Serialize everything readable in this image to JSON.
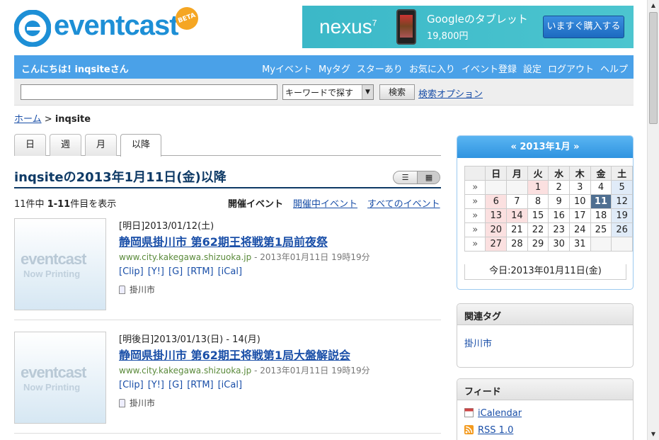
{
  "logo": {
    "text": "eventcast",
    "badge": "BETA"
  },
  "ad": {
    "brand": "nexus",
    "line1": "Googleのタブレット",
    "line2": "19,800円",
    "button": "いますぐ購入する"
  },
  "nav": {
    "greeting": "こんにちは! inqsiteさん",
    "links": [
      "Myイベント",
      "Myタグ",
      "スターあり",
      "お気に入り",
      "イベント登録",
      "設定",
      "ログアウト",
      "ヘルプ"
    ]
  },
  "search": {
    "input_value": "",
    "select_value": "キーワードで探す",
    "button": "検索",
    "options_link": "検索オプション"
  },
  "breadcrumb": {
    "home": "ホーム",
    "sep": ">",
    "current": "inqsite"
  },
  "tabs": [
    "日",
    "週",
    "月",
    "以降"
  ],
  "active_tab": "以降",
  "heading": "inqsiteの2013年1月11日(金)以降",
  "view_toggle": {
    "list": "☰",
    "grid": "▦"
  },
  "count": {
    "prefix": "11件中 ",
    "range": "1-11",
    "suffix": "件目を表示"
  },
  "filters": {
    "current": "開催イベント",
    "ongoing": "開催中イベント",
    "all": "すべてのイベント"
  },
  "events": [
    {
      "date": "[明日]2013/01/12(土)",
      "title": "静岡県掛川市 第62期王将戦第1局前夜祭",
      "url": "www.city.kakegawa.shizuoka.jp",
      "sep": " - ",
      "time": "2013年01月11日 19時19分",
      "links": [
        "[Clip]",
        "[Y!]",
        "[G]",
        "[RTM]",
        "[iCal]"
      ],
      "tag": "掛川市",
      "thumb_word": "eventcast",
      "thumb_sub": "Now Printing"
    },
    {
      "date": "[明後日]2013/01/13(日) - 14(月)",
      "title": "静岡県掛川市 第62期王将戦第1局大盤解説会",
      "url": "www.city.kakegawa.shizuoka.jp",
      "sep": " - ",
      "time": "2013年01月11日 19時19分",
      "links": [
        "[Clip]",
        "[Y!]",
        "[G]",
        "[RTM]",
        "[iCal]"
      ],
      "tag": "掛川市",
      "thumb_word": "eventcast",
      "thumb_sub": "Now Printing"
    }
  ],
  "calendar": {
    "title": "« 2013年1月 »",
    "weekdays": [
      "日",
      "月",
      "火",
      "水",
      "木",
      "金",
      "土"
    ],
    "week_arrow": "»",
    "weeks": [
      [
        "",
        "",
        "1",
        "2",
        "3",
        "4",
        "5"
      ],
      [
        "6",
        "7",
        "8",
        "9",
        "10",
        "11",
        "12"
      ],
      [
        "13",
        "14",
        "15",
        "16",
        "17",
        "18",
        "19"
      ],
      [
        "20",
        "21",
        "22",
        "23",
        "24",
        "25",
        "26"
      ],
      [
        "27",
        "28",
        "29",
        "30",
        "31",
        "",
        ""
      ]
    ],
    "holidays": [
      "1",
      "14"
    ],
    "today": "11",
    "today_label": "今日:2013年01月11日(金)"
  },
  "related_tags": {
    "title": "関連タグ",
    "items": [
      "掛川市"
    ]
  },
  "feeds": {
    "title": "フィード",
    "items": [
      "iCalendar",
      "RSS 1.0"
    ]
  },
  "colors": {
    "nav_bg": "#4aa1e8",
    "link": "#1a4fa8",
    "heading": "#0e3a66",
    "today": "#4f6f91"
  }
}
